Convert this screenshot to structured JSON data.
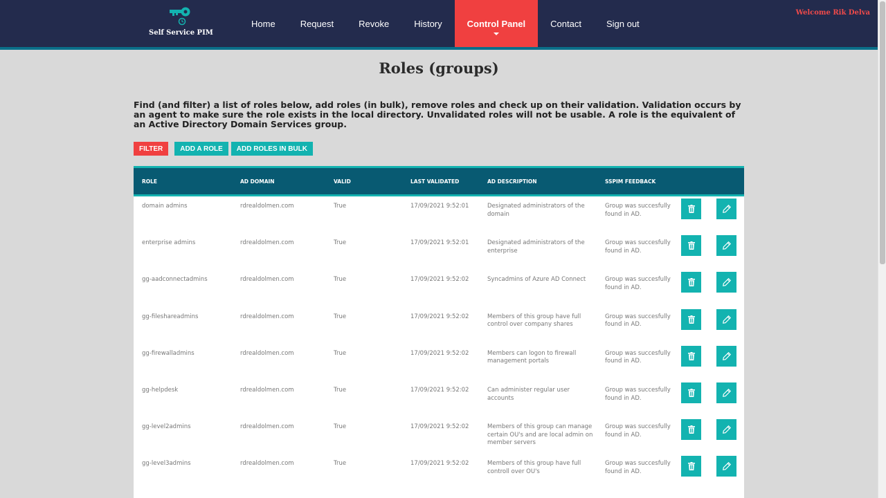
{
  "header": {
    "app_name": "Self Service PIM",
    "nav": [
      "Home",
      "Request",
      "Revoke",
      "History",
      "Control Panel",
      "Contact",
      "Sign out"
    ],
    "active_nav": "Control Panel",
    "welcome": "Welcome Rik Delva"
  },
  "colors": {
    "navbar": "#232b4d",
    "accent_red": "#f04040",
    "accent_teal": "#13b3b0",
    "table_header": "#085a72"
  },
  "page": {
    "title": "Roles (groups)",
    "intro": "Find (and filter) a list of roles below, add roles (in bulk), remove roles and check up on their validation. Validation occurs by an agent to make sure the role exists in the local directory. Unvalidated roles will not be usable. A role is the equivalent of an Active Directory Domain Services group."
  },
  "buttons": {
    "filter": "Filter",
    "add_role": "Add a role",
    "add_bulk": "Add roles in bulk"
  },
  "table": {
    "headers": [
      "ROLE",
      "AD DOMAIN",
      "VALID",
      "LAST VALIDATED",
      "AD DESCRIPTION",
      "SSPIM FEEDBACK"
    ],
    "rows": [
      {
        "role": "domain admins",
        "domain": "rdrealdolmen.com",
        "valid": "True",
        "validated": "17/09/2021 9:52:01",
        "description": "Designated administrators of the domain",
        "feedback": "Group was succesfully found in AD."
      },
      {
        "role": "enterprise admins",
        "domain": "rdrealdolmen.com",
        "valid": "True",
        "validated": "17/09/2021 9:52:01",
        "description": "Designated administrators of the enterprise",
        "feedback": "Group was succesfully found in AD."
      },
      {
        "role": "gg-aadconnectadmins",
        "domain": "rdrealdolmen.com",
        "valid": "True",
        "validated": "17/09/2021 9:52:02",
        "description": "Syncadmins of Azure AD Connect",
        "feedback": "Group was succesfully found in AD."
      },
      {
        "role": "gg-fileshareadmins",
        "domain": "rdrealdolmen.com",
        "valid": "True",
        "validated": "17/09/2021 9:52:02",
        "description": "Members of this group have full control over company shares",
        "feedback": "Group was succesfully found in AD."
      },
      {
        "role": "gg-firewalladmins",
        "domain": "rdrealdolmen.com",
        "valid": "True",
        "validated": "17/09/2021 9:52:02",
        "description": "Members can logon to firewall management portals",
        "feedback": "Group was succesfully found in AD."
      },
      {
        "role": "gg-helpdesk",
        "domain": "rdrealdolmen.com",
        "valid": "True",
        "validated": "17/09/2021 9:52:02",
        "description": "Can administer regular user accounts",
        "feedback": "Group was succesfully found in AD."
      },
      {
        "role": "gg-level2admins",
        "domain": "rdrealdolmen.com",
        "valid": "True",
        "validated": "17/09/2021 9:52:02",
        "description": "Members of this group can manage certain OU's and are local admin on member servers",
        "feedback": "Group was succesfully found in AD."
      },
      {
        "role": "gg-level3admins",
        "domain": "rdrealdolmen.com",
        "valid": "True",
        "validated": "17/09/2021 9:52:02",
        "description": "Members of this group have full controll over OU's",
        "feedback": "Group was succesfully found in AD."
      }
    ],
    "row_icons": [
      "trash-icon",
      "pencil-icon"
    ]
  }
}
